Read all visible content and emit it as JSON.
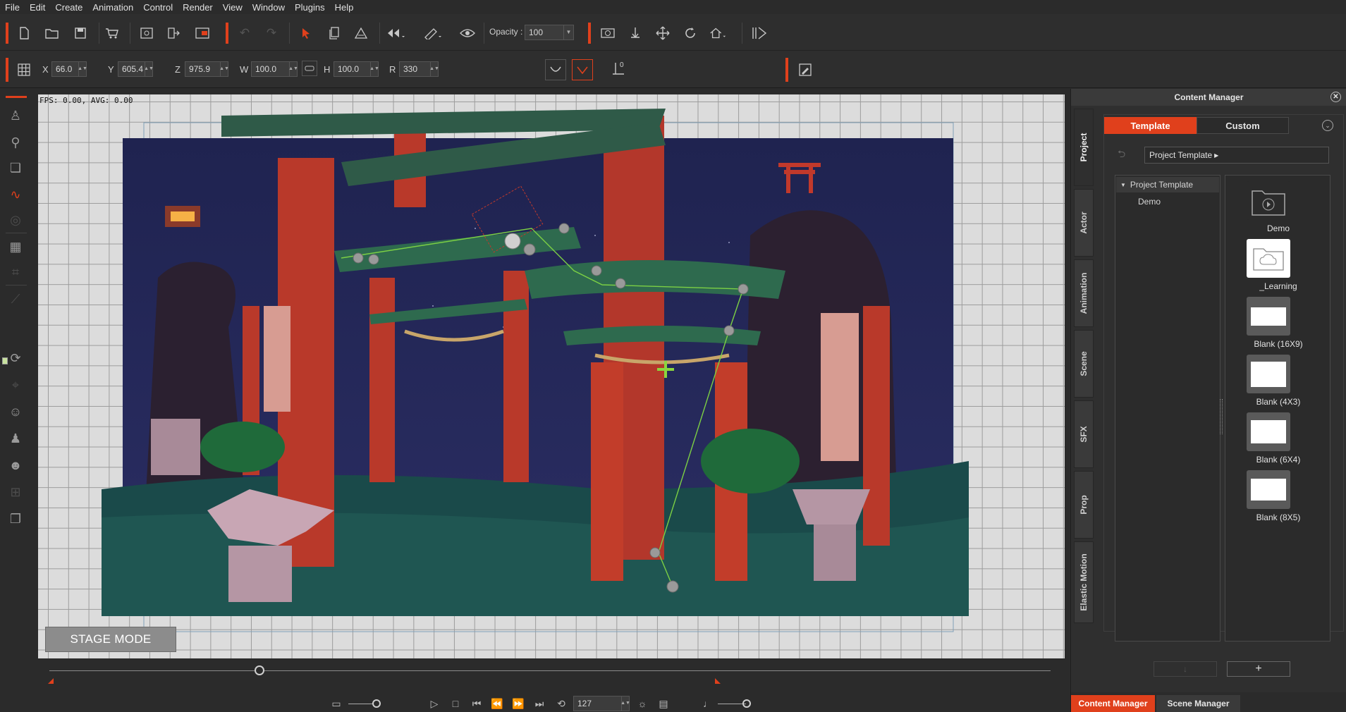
{
  "menu": [
    "File",
    "Edit",
    "Create",
    "Animation",
    "Control",
    "Render",
    "View",
    "Window",
    "Plugins",
    "Help"
  ],
  "toolbar": {
    "opacity_label": "Opacity :",
    "opacity_value": "100",
    "icons": [
      "new-file-icon",
      "open-folder-icon",
      "save-icon",
      "store-icon",
      "preview-icon",
      "export-icon",
      "render-icon",
      "undo-icon",
      "redo-icon",
      "select-icon",
      "copy-icon",
      "paint-icon",
      "flip-icon",
      "ruler-icon",
      "eye-icon",
      "camera-icon",
      "anchor-icon",
      "move-icon",
      "rotate-icon",
      "home-icon",
      "panel-icon"
    ]
  },
  "transform": {
    "x_label": "X",
    "x_value": "66.0",
    "y_label": "Y",
    "y_value": "605.4",
    "z_label": "Z",
    "z_value": "975.9",
    "w_label": "W",
    "w_value": "100.0",
    "h_label": "H",
    "h_value": "100.0",
    "r_label": "R",
    "r_value": "330",
    "offset_label": "0"
  },
  "stage": {
    "fps_text": "FPS: 0.00, AVG: 0.00",
    "mode_label": "STAGE MODE"
  },
  "timeline": {
    "frame_value": "127"
  },
  "content_manager": {
    "title": "Content Manager",
    "vertical_tabs": [
      "Project",
      "Actor",
      "Animation",
      "Scene",
      "SFX",
      "Prop",
      "Elastic Motion"
    ],
    "tabs": [
      "Template",
      "Custom"
    ],
    "path": "Project Template",
    "tree_root": "Project Template",
    "tree_child": "Demo",
    "items": [
      "Demo",
      "_Learning",
      "Blank (16X9)",
      "Blank (4X3)",
      "Blank (6X4)",
      "Blank (8X5)"
    ],
    "add_label": "+",
    "bottom_tabs": [
      "Content Manager",
      "Scene Manager"
    ]
  },
  "colors": {
    "accent": "#e0401c",
    "panel": "#2f2f2f",
    "stage_grid": "#dcdcdc"
  }
}
